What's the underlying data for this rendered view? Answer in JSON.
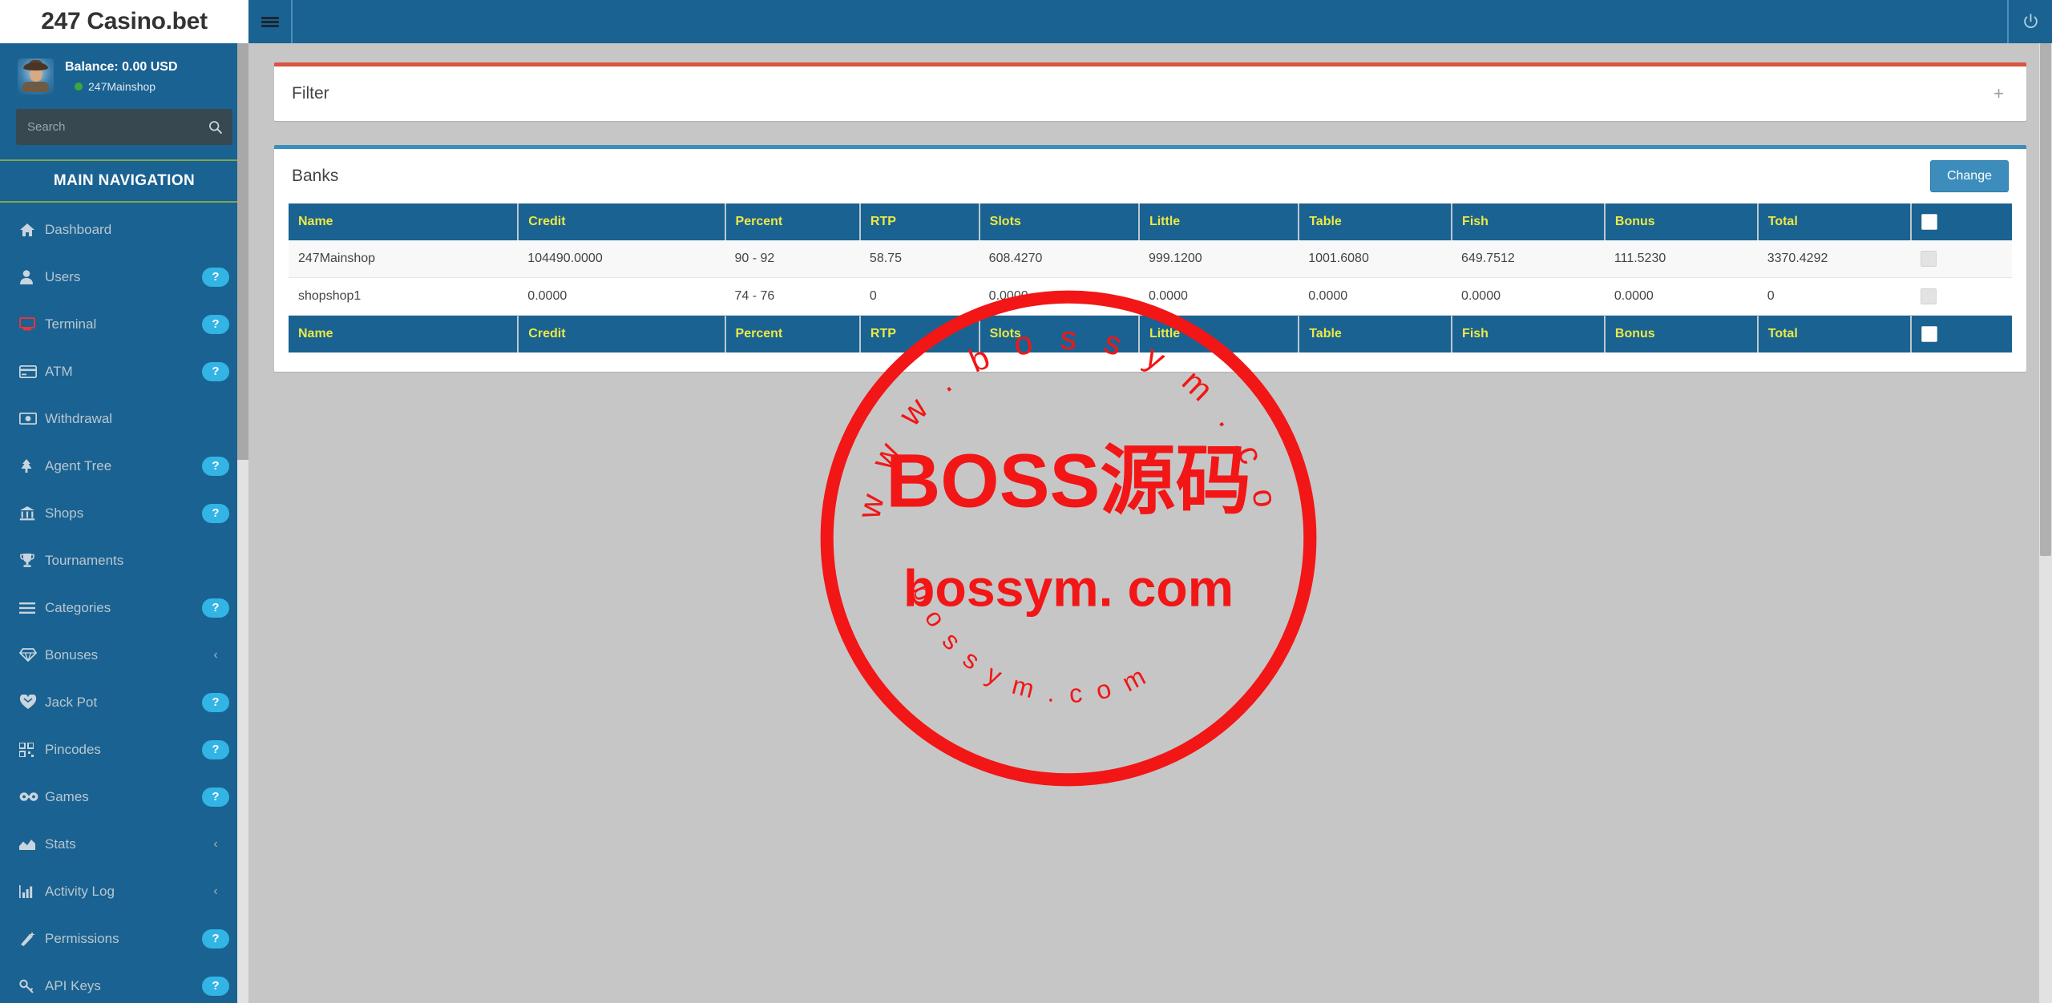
{
  "app": {
    "logo": "247 Casino.bet"
  },
  "sidebar": {
    "user": {
      "balance": "Balance: 0.00 USD",
      "username": "247Mainshop",
      "status": "online"
    },
    "search": {
      "placeholder": "Search",
      "value": "",
      "icon": "search-icon"
    },
    "nav_header": "MAIN NAVIGATION",
    "items": [
      {
        "label": "Dashboard",
        "icon": "home-icon",
        "badge": "",
        "chevron": false
      },
      {
        "label": "Users",
        "icon": "user-icon",
        "badge": "?",
        "chevron": false
      },
      {
        "label": "Terminal",
        "icon": "terminal-icon",
        "badge": "?",
        "chevron": false
      },
      {
        "label": "ATM",
        "icon": "card-icon",
        "badge": "?",
        "chevron": false
      },
      {
        "label": "Withdrawal",
        "icon": "money-icon",
        "badge": "",
        "chevron": false
      },
      {
        "label": "Agent Tree",
        "icon": "tree-icon",
        "badge": "?",
        "chevron": false
      },
      {
        "label": "Shops",
        "icon": "bank-icon",
        "badge": "?",
        "chevron": false
      },
      {
        "label": "Tournaments",
        "icon": "trophy-icon",
        "badge": "",
        "chevron": false
      },
      {
        "label": "Categories",
        "icon": "list-icon",
        "badge": "?",
        "chevron": false
      },
      {
        "label": "Bonuses",
        "icon": "diamond-icon",
        "badge": "",
        "chevron": true
      },
      {
        "label": "Jack Pot",
        "icon": "heart-gem-icon",
        "badge": "?",
        "chevron": false
      },
      {
        "label": "Pincodes",
        "icon": "qr-icon",
        "badge": "?",
        "chevron": false
      },
      {
        "label": "Games",
        "icon": "mask-icon",
        "badge": "?",
        "chevron": false
      },
      {
        "label": "Stats",
        "icon": "area-chart-icon",
        "badge": "",
        "chevron": true
      },
      {
        "label": "Activity Log",
        "icon": "bar-chart-icon",
        "badge": "",
        "chevron": true
      },
      {
        "label": "Permissions",
        "icon": "magic-icon",
        "badge": "?",
        "chevron": false
      },
      {
        "label": "API Keys",
        "icon": "key-icon",
        "badge": "?",
        "chevron": false
      }
    ]
  },
  "topbar": {
    "menu_toggle_icon": "hamburger-icon",
    "power_icon": "power-icon"
  },
  "filter_box": {
    "title": "Filter",
    "expand_label": "+"
  },
  "banks_box": {
    "title": "Banks",
    "change_label": "Change",
    "columns": [
      "Name",
      "Credit",
      "Percent",
      "RTP",
      "Slots",
      "Little",
      "Table",
      "Fish",
      "Bonus",
      "Total",
      ""
    ],
    "rows": [
      {
        "Name": "247Mainshop",
        "Credit": "104490.0000",
        "Percent": "90 - 92",
        "RTP": "58.75",
        "Slots": "608.4270",
        "Little": "999.1200",
        "Table": "1001.6080",
        "Fish": "649.7512",
        "Bonus": "111.5230",
        "Total": "3370.4292",
        "selected": false
      },
      {
        "Name": "shopshop1",
        "Credit": "0.0000",
        "Percent": "74 - 76",
        "RTP": "0",
        "Slots": "0.0000",
        "Little": "0.0000",
        "Table": "0.0000",
        "Fish": "0.0000",
        "Bonus": "0.0000",
        "Total": "0",
        "selected": false
      }
    ],
    "footer_columns": [
      "Name",
      "Credit",
      "Percent",
      "RTP",
      "Slots",
      "Little",
      "Table",
      "Fish",
      "Bonus",
      "Total",
      ""
    ]
  },
  "watermark": {
    "center_text": "BOSS源码",
    "sub_text": "bossym. com",
    "arc_top": "www.bossym.com",
    "arc_bottom": "bossym.com",
    "color": "#f21616"
  },
  "colors": {
    "sidebar_bg": "#1a6291",
    "header_bg": "#1a6291",
    "accent": "#3c8dbc",
    "danger": "#d9553f",
    "badge": "#32b4e5",
    "th_text": "#ece946",
    "nav_divider": "#7fa64a",
    "content_bg": "#c6c6c6"
  }
}
